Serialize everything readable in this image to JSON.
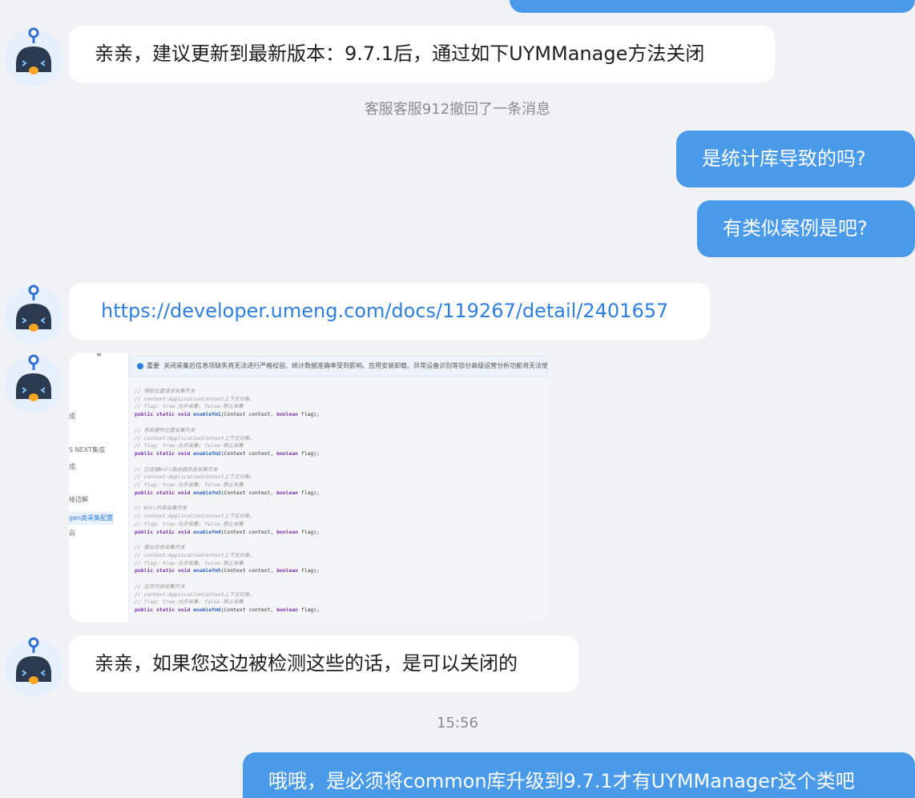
{
  "messages": {
    "m1": "亲亲，建议更新到最新版本：9.7.1后，通过如下UYMManage方法关闭",
    "system_recall": "客服客服912撤回了一条消息",
    "m2": "是统计库导致的吗?",
    "m3": "有类似案例是吧?",
    "m4_link": "https://developer.umeng.com/docs/119267/detail/2401657",
    "m5": "亲亲，如果您这边被检测这些的话，是可以关闭的",
    "time": "15:56",
    "m6": "哦哦，是必须将common库升级到9.7.1才有UYMManager这个类吧"
  },
  "image": {
    "sidebar": [
      "≡",
      "成",
      "S NEXT集成",
      "成",
      "接边解",
      "gen类采集配置",
      "白"
    ],
    "banner_label": "重要",
    "banner_text": "关闭采集后信息项缺失将无法进行严格校验、统计数据准确率受到影响、应用安装卸载、异常设备识别等部分高级运营分析功能将无法使用，请谨慎改动!",
    "blocks": [
      {
        "c1": "// 辅助位置请求采集开关",
        "c2": "// context:ApplicationContext上下文对象。",
        "c3": "// flag: true-允许采集; false-禁止采集",
        "fn": "enableYm1"
      },
      {
        "c1": "// 系统硬件位置采集开关",
        "c2": "// context:ApplicationContext上下文对象。",
        "c3": "// flag: true-允许采集; false-禁止采集",
        "fn": "enableYm2"
      },
      {
        "c1": "// 已连接WiFi路由器信息采集开关",
        "c2": "// context:ApplicationContext上下文对象。",
        "c3": "// flag: true-允许采集; false-禁止采集",
        "fn": "enableYm3"
      },
      {
        "c1": "// WiFi列表采集开关",
        "c2": "// context:ApplicationContext上下文对象。",
        "c3": "// flag: true-允许采集; false-禁止采集",
        "fn": "enableYm4"
      },
      {
        "c1": "// 基站信息采集开关",
        "c2": "// context:ApplicationContext上下文对象。",
        "c3": "// flag: true-允许采集; false-禁止采集",
        "fn": "enableYm5"
      },
      {
        "c1": "// 应用列表采集开关",
        "c2": "// context:ApplicationContext上下文对象。",
        "c3": "// flag: true-允许采集; false-禁止采集",
        "fn": "enableYm6"
      }
    ],
    "sig_prefix_public": "public",
    "sig_prefix_static": "static",
    "sig_prefix_void": "void",
    "sig_param1": "(Context context,",
    "sig_kw_boolean": "boolean",
    "sig_param2": "flag);"
  },
  "colors": {
    "accent_bubble": "#4a9aea",
    "background": "#f1f2f5",
    "link": "#2f7fe0"
  },
  "icons": {
    "agent_avatar": "robot-avatar-icon",
    "info": "info-icon"
  }
}
